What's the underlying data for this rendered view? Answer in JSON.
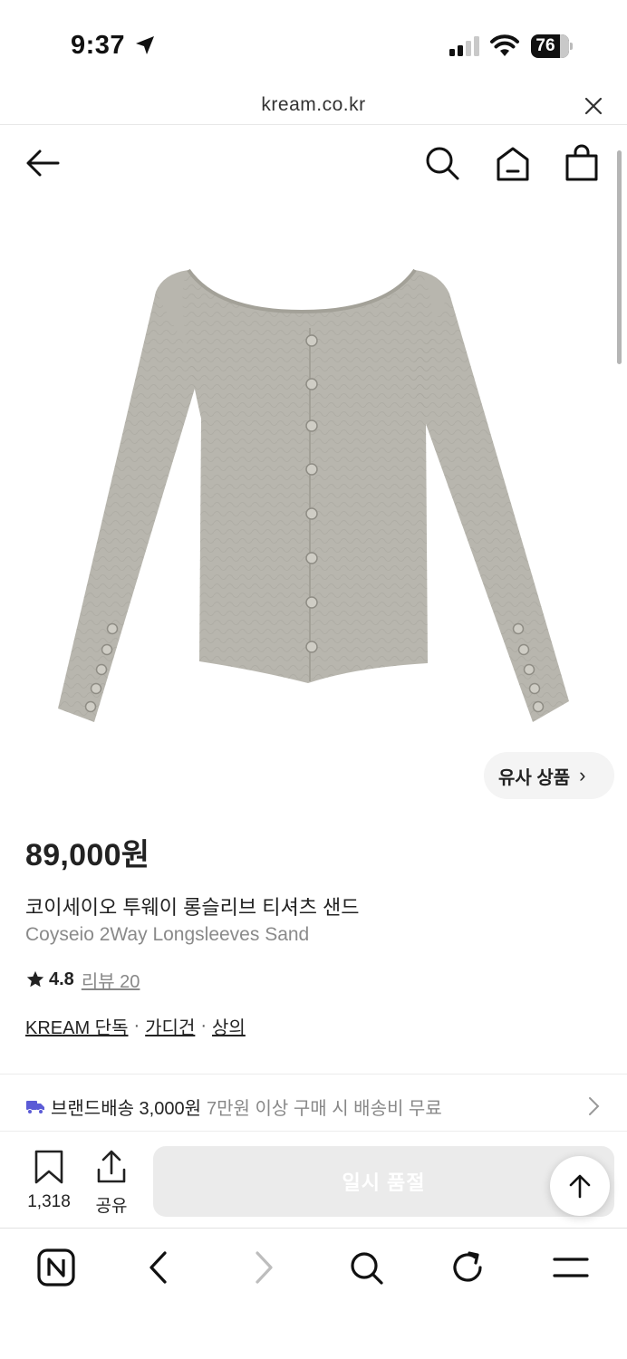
{
  "status_bar": {
    "time": "9:37",
    "battery_level": "76",
    "battery_fraction": 0.76
  },
  "url_bar": {
    "url": "kream.co.kr"
  },
  "header": {
    "icons": [
      "back-arrow-icon",
      "search-icon",
      "home-icon",
      "shopping-bag-icon"
    ]
  },
  "product": {
    "similar_label": "유사 상품",
    "price": "89,000원",
    "name_ko": "코이세이오 투웨이 롱슬리브 티셔츠 샌드",
    "name_en": "Coyseio 2Way Longsleeves Sand",
    "rating": "4.8",
    "review_label": "리뷰 20",
    "tags": [
      "KREAM 단독",
      "가디건",
      "상의"
    ]
  },
  "shipping": {
    "title": "브랜드배송 3,000원",
    "note": "7만원 이상 구매 시 배송비 무료",
    "accent": "#5b5bd6"
  },
  "actions": {
    "bookmark_count": "1,318",
    "share_label": "공유",
    "soldout_label": "일시 품절"
  },
  "colors": {
    "text": "#222222",
    "muted": "#8a8a8a",
    "soldout_bg": "#ebebeb",
    "garment": "#b8b6ae"
  }
}
